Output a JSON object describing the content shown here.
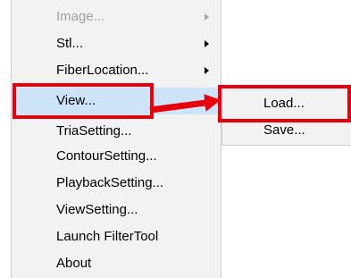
{
  "context_menu": {
    "items": [
      {
        "label": "Image...",
        "has_submenu": true,
        "disabled": true
      },
      {
        "label": "Stl...",
        "has_submenu": true
      },
      {
        "label": "FiberLocation...",
        "has_submenu": true
      },
      {
        "label": "View...",
        "has_submenu": true,
        "highlighted": true
      },
      {
        "label": "TriaSetting..."
      },
      {
        "label": "ContourSetting..."
      },
      {
        "label": "PlaybackSetting..."
      },
      {
        "label": "ViewSetting..."
      },
      {
        "label": "Launch FilterTool"
      },
      {
        "label": "About"
      }
    ]
  },
  "view_submenu": {
    "items": [
      {
        "label": "Load..."
      },
      {
        "label": "Save..."
      }
    ]
  },
  "colors": {
    "highlight": "#cde3f7",
    "annotation": "#e8000b",
    "menu_background": "#f2f2f2",
    "disabled_text": "#a0a0a0"
  }
}
